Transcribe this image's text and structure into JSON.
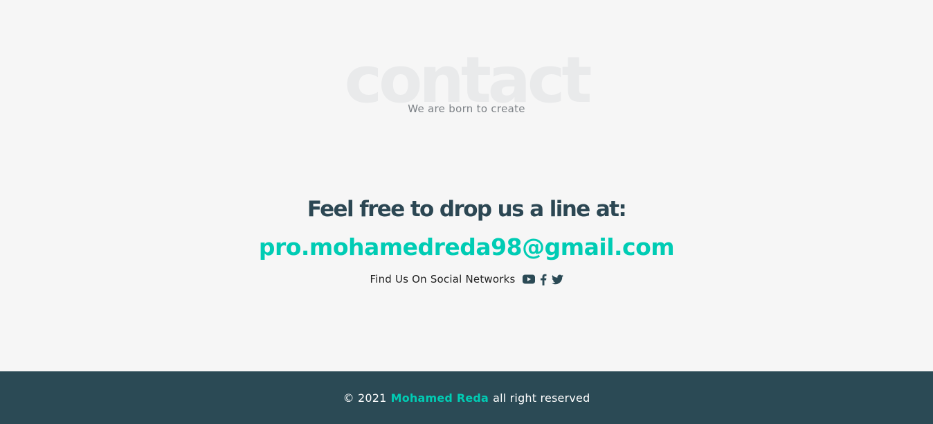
{
  "contact": {
    "background_word": "contact",
    "subtitle": "We are born to create",
    "headline": "Feel free to drop us a line at:",
    "email": "pro.mohamedreda98@gmail.com",
    "social_label": "Find Us On Social Networks",
    "social_icons": [
      "youtube-icon",
      "facebook-icon",
      "twitter-icon"
    ]
  },
  "footer": {
    "prefix": "© 2021",
    "brand": "Mohamed Reda",
    "suffix": "all right reserved"
  },
  "colors": {
    "background": "#f6f6f6",
    "accent": "#00ccb4",
    "dark": "#2b4a55",
    "watermark": "#e9eaeb"
  }
}
